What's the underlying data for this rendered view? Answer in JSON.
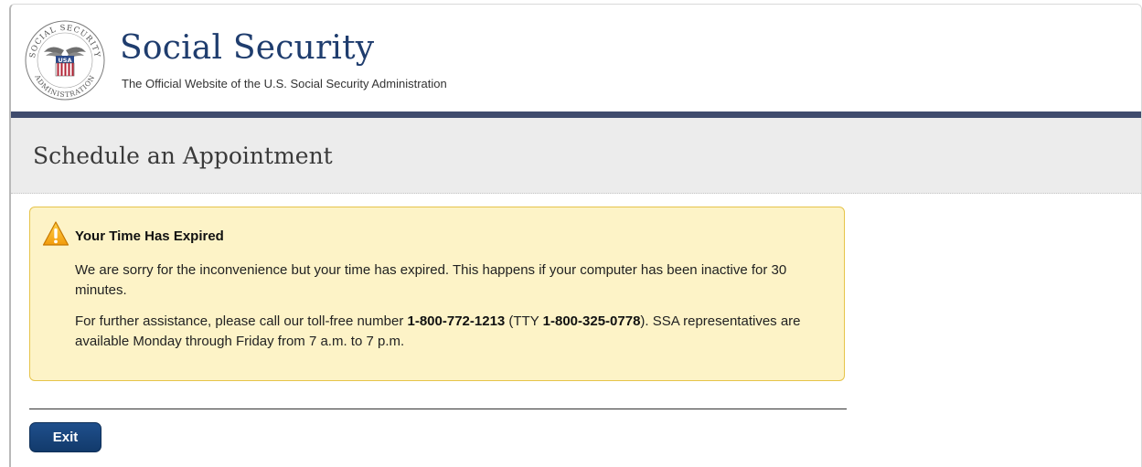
{
  "header": {
    "site_title": "Social Security",
    "tagline": "The Official Website of the U.S. Social Security Administration",
    "logo": {
      "arc_text": "SOCIAL SECURITY",
      "bottom_text": "ADMINISTRATION",
      "shield_text": "USA",
      "icon": "ssa-seal-icon"
    },
    "bar_color": "#3f4b6d",
    "title_color": "#1f3d6e"
  },
  "page": {
    "title": "Schedule an Appointment"
  },
  "alert": {
    "icon": "warning-icon",
    "title": "Your Time Has Expired",
    "paragraph1": "We are sorry for the inconvenience but your time has expired. This happens if your computer has been inactive for 30 minutes.",
    "p2_prefix": "For further assistance, please call our toll-free number ",
    "phone": "1-800-772-1213",
    "p2_tty_prefix": " (TTY ",
    "tty_phone": "1-800-325-0778",
    "p2_suffix": "). SSA representatives are available Monday through Friday from 7 a.m. to 7 p.m.",
    "background_color": "#fdf3c7",
    "border_color": "#e6c44a"
  },
  "actions": {
    "exit_label": "Exit",
    "button_color": "#1a4379"
  }
}
